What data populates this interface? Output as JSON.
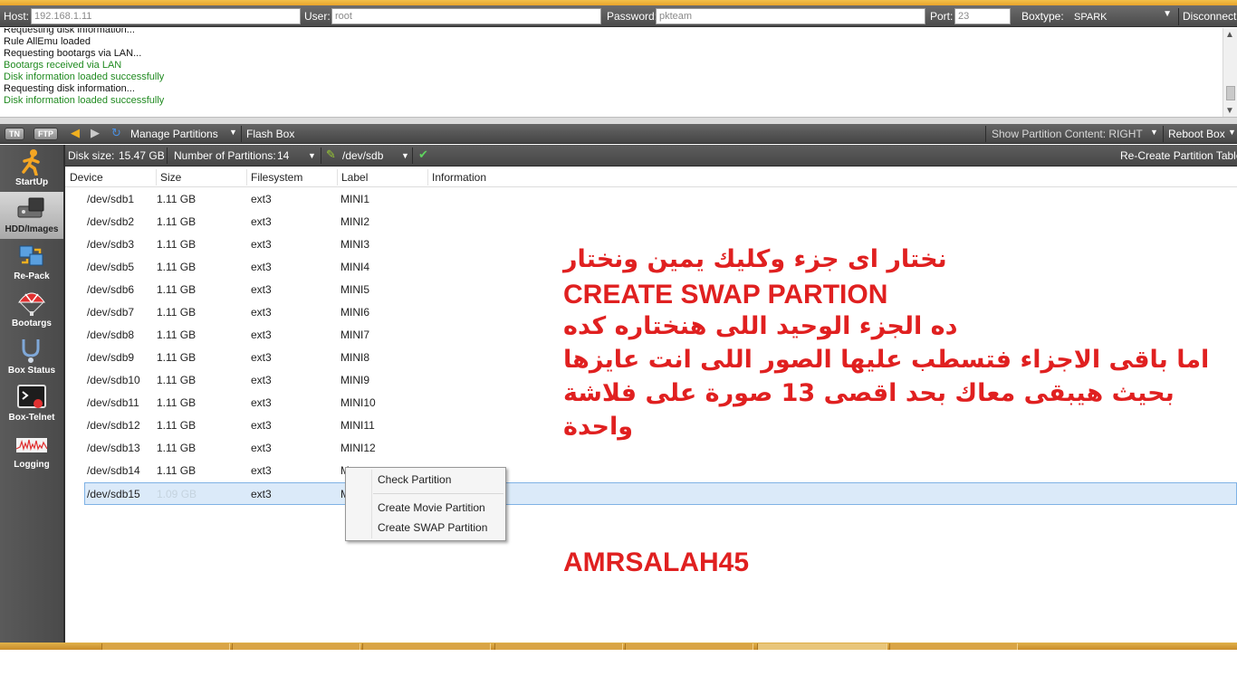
{
  "connection": {
    "host_label": "Host:",
    "host_value": "192.168.1.11",
    "user_label": "User:",
    "user_value": "root",
    "password_label": "Password:",
    "password_value": "pkteam",
    "port_label": "Port:",
    "port_value": "23",
    "boxtype_label": "Boxtype:",
    "boxtype_value": "SPARK",
    "disconnect_label": "Disconnect"
  },
  "log": {
    "lines": [
      {
        "text": "Requesting disk information...",
        "kind": "black"
      },
      {
        "text": "Rule AllEmu loaded",
        "kind": "black"
      },
      {
        "text": "Requesting bootargs via LAN...",
        "kind": "black"
      },
      {
        "text": "Bootargs received via LAN",
        "kind": "green"
      },
      {
        "text": "Disk information loaded successfully",
        "kind": "green"
      },
      {
        "text": "Requesting disk information...",
        "kind": "black"
      },
      {
        "text": "Disk information loaded successfully",
        "kind": "green"
      }
    ]
  },
  "toolbar": {
    "tn_label": "TN",
    "ftp_label": "FTP",
    "manage_partitions_label": "Manage Partitions",
    "flash_box_label": "Flash Box",
    "show_partition_content_label": "Show Partition Content: RIGHT",
    "reboot_box_label": "Reboot Box"
  },
  "subbar": {
    "disk_size_label": "Disk size:",
    "disk_size_value": "15.47 GB",
    "num_partitions_label": "Number of Partitions:",
    "num_partitions_value": "14",
    "device_value": "/dev/sdb",
    "recreate_label": "Re-Create Partition Table"
  },
  "sidebar": {
    "items": [
      {
        "label": "StartUp",
        "icon": "runner-icon"
      },
      {
        "label": "HDD/Images",
        "icon": "hdd-icon"
      },
      {
        "label": "Re-Pack",
        "icon": "repack-icon"
      },
      {
        "label": "Bootargs",
        "icon": "parachute-icon"
      },
      {
        "label": "Box Status",
        "icon": "stethoscope-icon"
      },
      {
        "label": "Box-Telnet",
        "icon": "terminal-icon"
      },
      {
        "label": "Logging",
        "icon": "waveform-icon"
      }
    ]
  },
  "table": {
    "headers": [
      "Device",
      "Size",
      "Filesystem",
      "Label",
      "Information"
    ],
    "rows": [
      {
        "device": "/dev/sdb1",
        "size": "1.11 GB",
        "fs": "ext3",
        "label": "MINI1"
      },
      {
        "device": "/dev/sdb2",
        "size": "1.11 GB",
        "fs": "ext3",
        "label": "MINI2"
      },
      {
        "device": "/dev/sdb3",
        "size": "1.11 GB",
        "fs": "ext3",
        "label": "MINI3"
      },
      {
        "device": "/dev/sdb5",
        "size": "1.11 GB",
        "fs": "ext3",
        "label": "MINI4"
      },
      {
        "device": "/dev/sdb6",
        "size": "1.11 GB",
        "fs": "ext3",
        "label": "MINI5"
      },
      {
        "device": "/dev/sdb7",
        "size": "1.11 GB",
        "fs": "ext3",
        "label": "MINI6"
      },
      {
        "device": "/dev/sdb8",
        "size": "1.11 GB",
        "fs": "ext3",
        "label": "MINI7"
      },
      {
        "device": "/dev/sdb9",
        "size": "1.11 GB",
        "fs": "ext3",
        "label": "MINI8"
      },
      {
        "device": "/dev/sdb10",
        "size": "1.11 GB",
        "fs": "ext3",
        "label": "MINI9"
      },
      {
        "device": "/dev/sdb11",
        "size": "1.11 GB",
        "fs": "ext3",
        "label": "MINI10"
      },
      {
        "device": "/dev/sdb12",
        "size": "1.11 GB",
        "fs": "ext3",
        "label": "MINI11"
      },
      {
        "device": "/dev/sdb13",
        "size": "1.11 GB",
        "fs": "ext3",
        "label": "MINI12"
      },
      {
        "device": "/dev/sdb14",
        "size": "1.11 GB",
        "fs": "ext3",
        "label": "M"
      },
      {
        "device": "/dev/sdb15",
        "size": "1.09 GB",
        "fs": "ext3",
        "label": "M"
      }
    ]
  },
  "context_menu": {
    "items": [
      "Check Partition",
      "Create Movie Partition",
      "Create SWAP Partition"
    ]
  },
  "annotation": {
    "line1": "نختار اى جزء وكليك يمين ونختار",
    "line2": "CREATE SWAP PARTION",
    "line3": "ده الجزء الوحيد اللى هنختاره كده",
    "line4": "اما باقى الاجزاء فتسطب عليها الصور اللى انت عايزها",
    "line5": "بحيث هيبقى معاك بحد اقصى 13 صورة على فلاشة",
    "line6": "واحدة",
    "signature": "AMRSALAH45"
  },
  "colors": {
    "annotation": "#e02020",
    "log_green": "#1f8a1f",
    "selected_row": "#dbeaf9"
  }
}
